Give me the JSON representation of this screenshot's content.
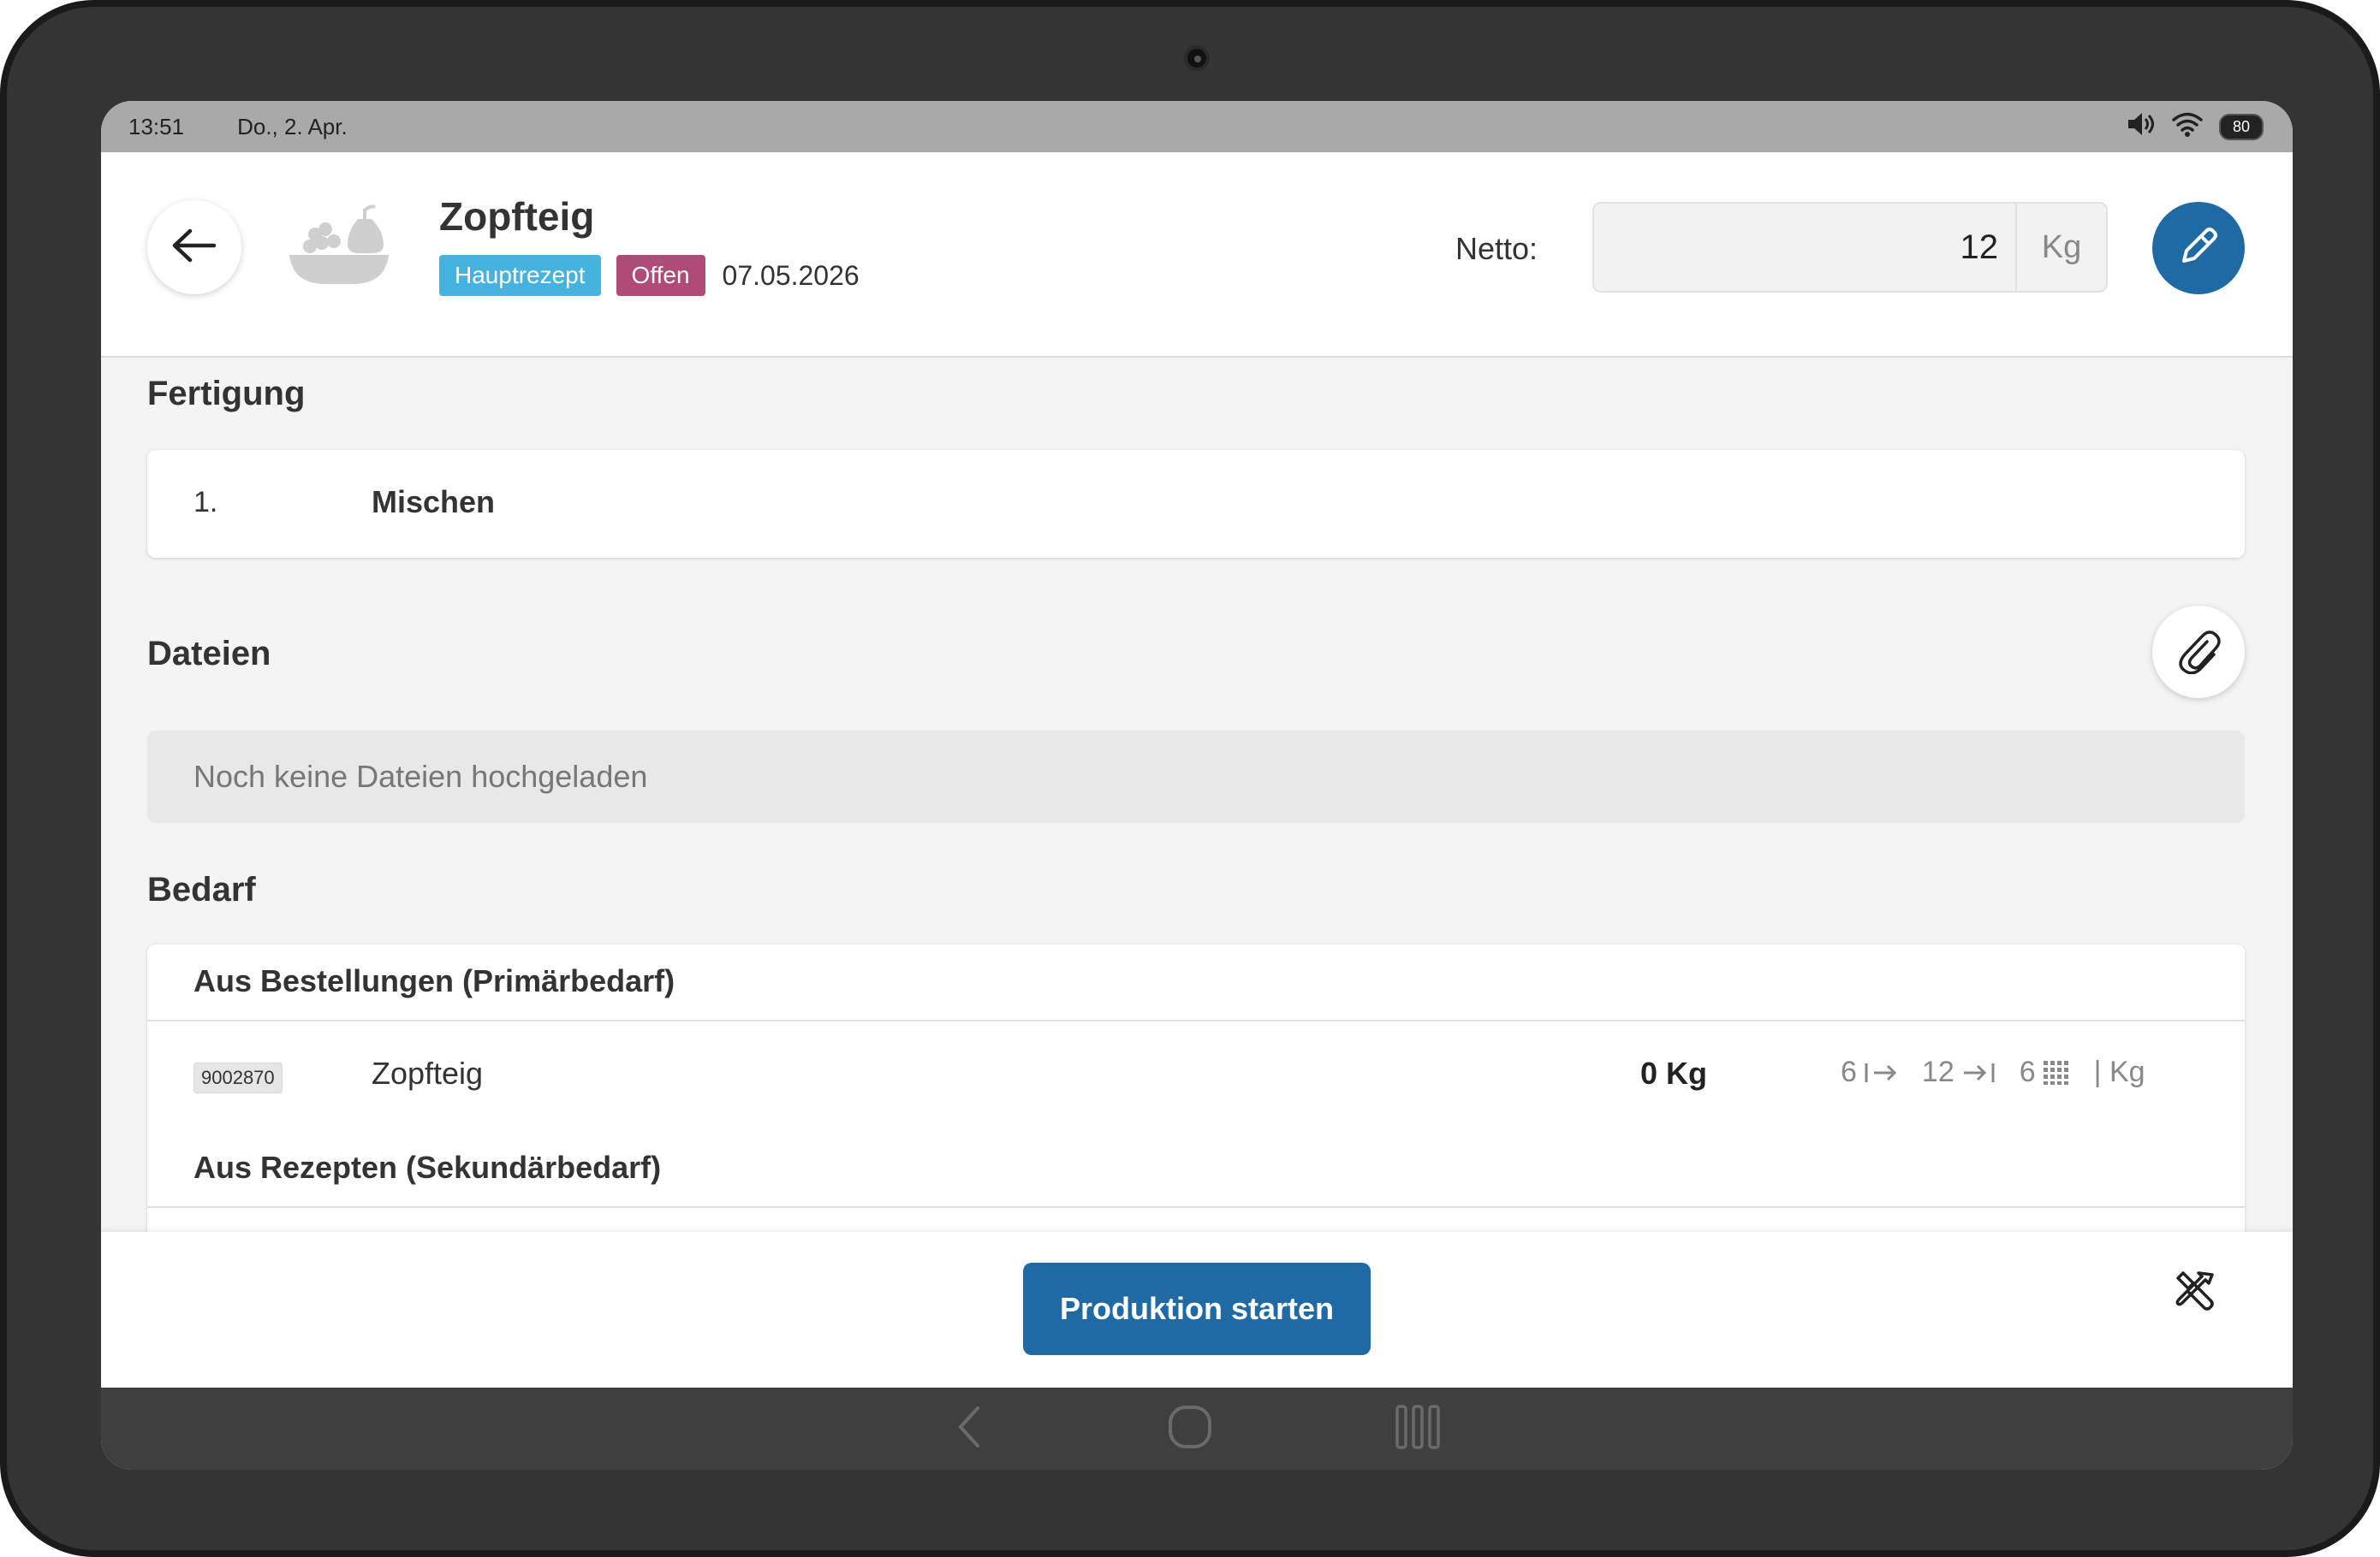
{
  "status_bar": {
    "time": "13:51",
    "date": "Do., 2. Apr.",
    "battery": "80"
  },
  "header": {
    "title": "Zopfteig",
    "tags": {
      "main": "Hauptrezept",
      "status": "Offen"
    },
    "date": "07.05.2026",
    "netto_label": "Netto:",
    "netto_value": "12",
    "netto_unit": "Kg"
  },
  "fertigung": {
    "title": "Fertigung",
    "steps": [
      {
        "number": "1.",
        "name": "Mischen"
      }
    ]
  },
  "dateien": {
    "title": "Dateien",
    "empty_text": "Noch keine Dateien hochgeladen"
  },
  "bedarf": {
    "title": "Bedarf",
    "primary_title": "Aus Bestellungen (Primärbedarf)",
    "items": [
      {
        "article_no": "9002870",
        "name": "Zopfteig",
        "quantity": "0 Kg",
        "min": "6",
        "max": "12",
        "grid": "6",
        "unit": "| Kg"
      }
    ],
    "secondary_title": "Aus Rezepten (Sekundärbedarf)"
  },
  "bottom": {
    "start_label": "Produktion starten"
  },
  "colors": {
    "primary": "#1f6aa5",
    "tag_main": "#46b3de",
    "tag_open": "#b04a76"
  }
}
